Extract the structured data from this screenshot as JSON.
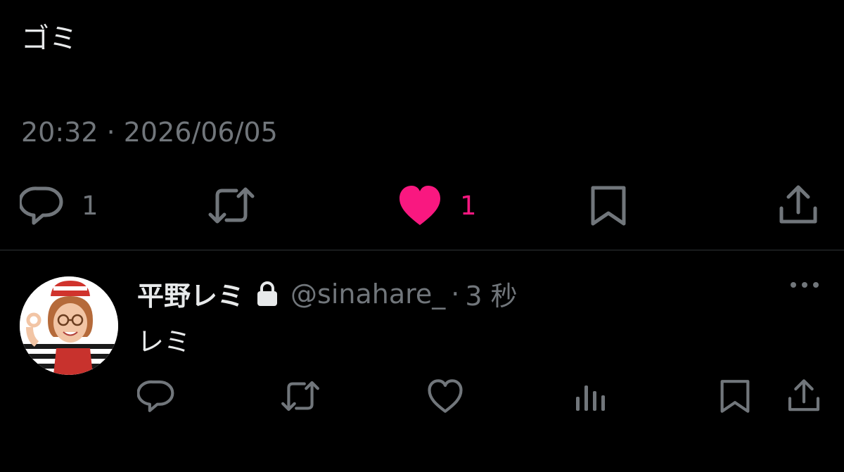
{
  "tweet": {
    "text": "ゴミ",
    "timestamp": "20:32 · 2026/06/05",
    "actions": {
      "reply_count": "1",
      "like_count": "1",
      "liked": true
    }
  },
  "reply": {
    "display_name": "平野レミ",
    "handle": "@sinahare_",
    "separator": "·",
    "time_ago": "3 秒",
    "text": "レミ",
    "protected": true
  },
  "colors": {
    "background": "#000000",
    "text": "#e7e9ea",
    "muted": "#71767b",
    "like": "#f91880",
    "divider": "#2f3336"
  },
  "icons": {
    "reply": "speech-bubble-icon",
    "retweet": "retweet-icon",
    "like": "heart-icon",
    "bookmark": "bookmark-icon",
    "share": "share-upload-icon",
    "views": "bar-chart-icon",
    "more": "ellipsis-icon",
    "protected": "lock-icon"
  }
}
